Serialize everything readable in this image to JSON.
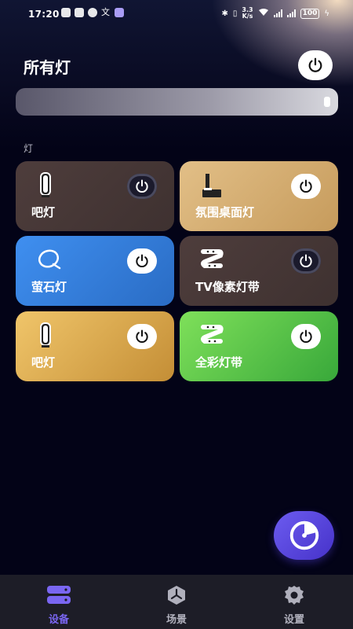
{
  "status": {
    "time": "17:20",
    "net_speed_top": "3.3",
    "net_speed_bottom": "K/s",
    "battery": "100"
  },
  "header": {
    "title": "所有灯"
  },
  "section_label": "灯",
  "lights": [
    {
      "name": "吧灯",
      "icon": "bar-lamp-icon",
      "on": false,
      "color": "#4a3a3a"
    },
    {
      "name": "氛围桌面灯",
      "icon": "desk-lamp-icon",
      "on": true,
      "color": "#d9b279"
    },
    {
      "name": "萤石灯",
      "icon": "ezviz-lamp-icon",
      "on": true,
      "color": "#3a86de"
    },
    {
      "name": "TV像素灯带",
      "icon": "light-strip-icon",
      "on": false,
      "color": "#4a3a3a"
    },
    {
      "name": "吧灯",
      "icon": "bar-lamp-icon",
      "on": true,
      "color": "#e4b45a"
    },
    {
      "name": "全彩灯带",
      "icon": "light-strip-icon",
      "on": true,
      "color": "#5fd04a"
    }
  ],
  "tabs": [
    {
      "label": "设备",
      "icon": "devices-icon",
      "active": true
    },
    {
      "label": "场景",
      "icon": "scenes-icon",
      "active": false
    },
    {
      "label": "设置",
      "icon": "settings-gear-icon",
      "active": false
    }
  ],
  "colors": {
    "accent": "#6c5cf0",
    "tab_active": "#7a66f2",
    "tab_inactive": "#b0b0bc"
  }
}
